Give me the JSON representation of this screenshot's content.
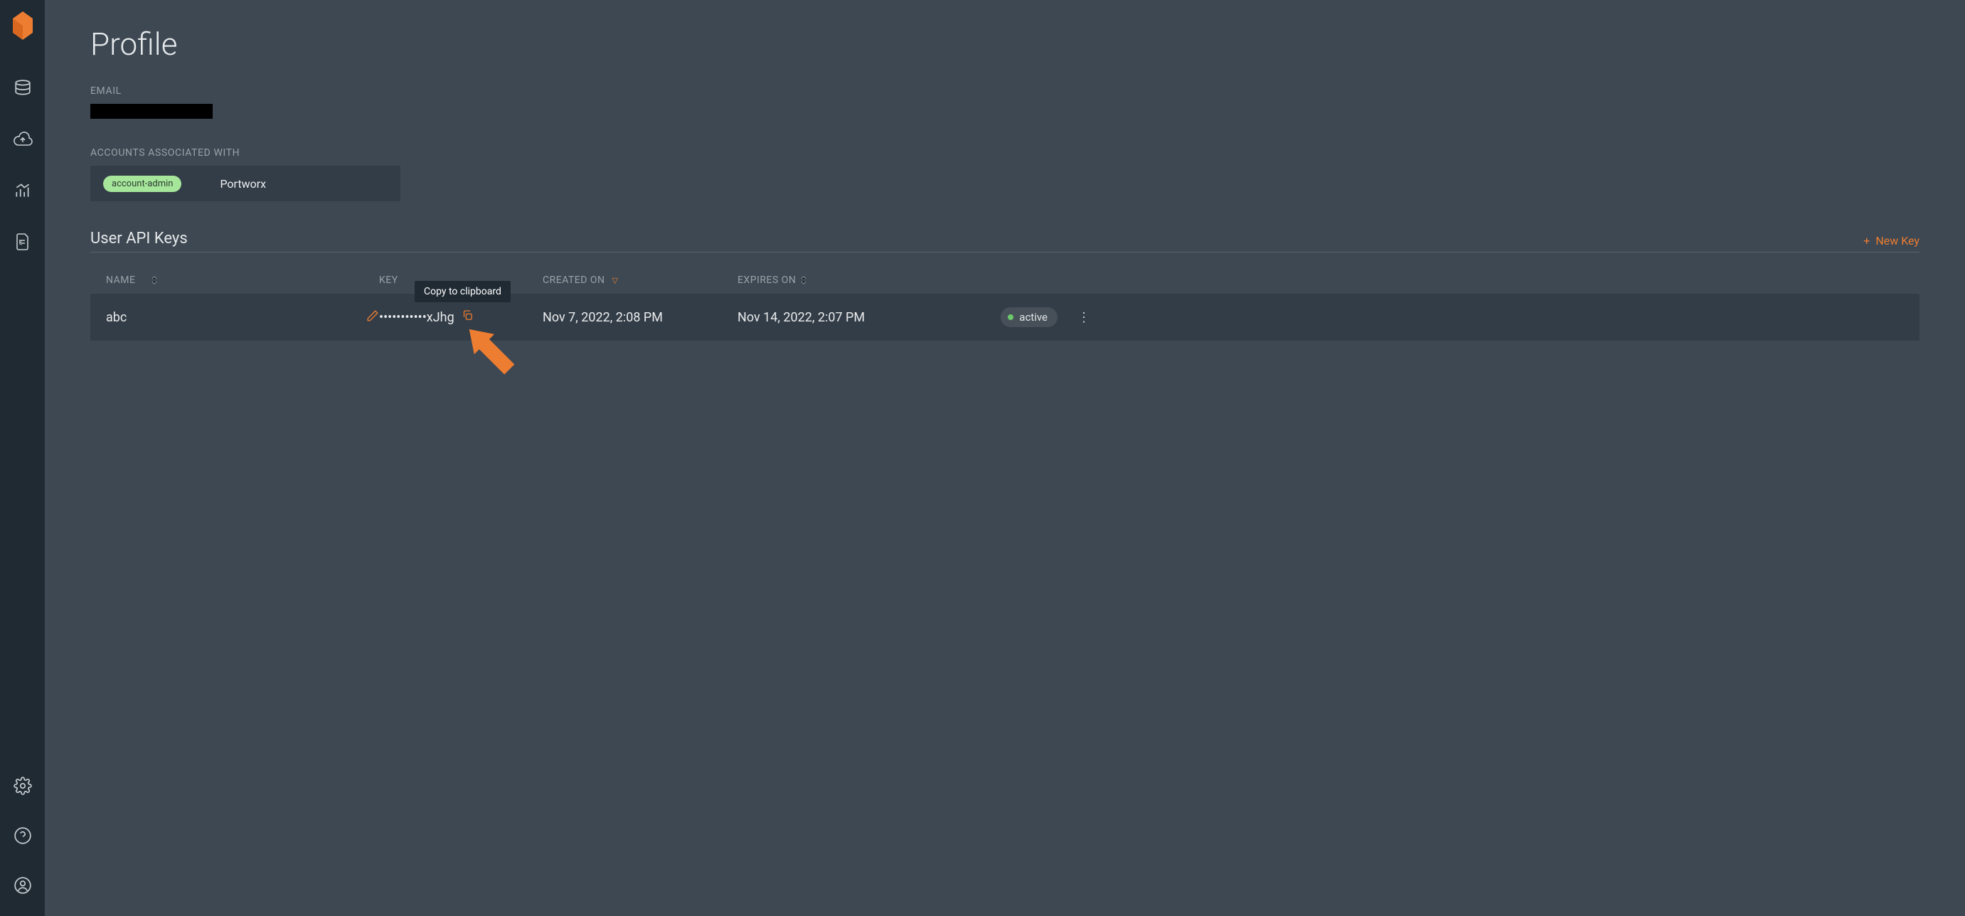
{
  "header": {
    "title": "Profile"
  },
  "labels": {
    "email": "EMAIL",
    "accounts": "ACCOUNTS ASSOCIATED WITH"
  },
  "account": {
    "role": "account-admin",
    "name": "Portworx"
  },
  "section": {
    "title": "User API Keys",
    "new_key": "New Key"
  },
  "table": {
    "headers": {
      "name": "NAME",
      "key": "KEY",
      "created": "CREATED ON",
      "expires": "EXPIRES ON"
    },
    "rows": [
      {
        "name": "abc",
        "key": "•••••••••••xJhg",
        "created": "Nov 7, 2022, 2:08 PM",
        "expires": "Nov 14, 2022, 2:07 PM",
        "status": "active"
      }
    ]
  },
  "tooltip": {
    "copy": "Copy to clipboard"
  }
}
